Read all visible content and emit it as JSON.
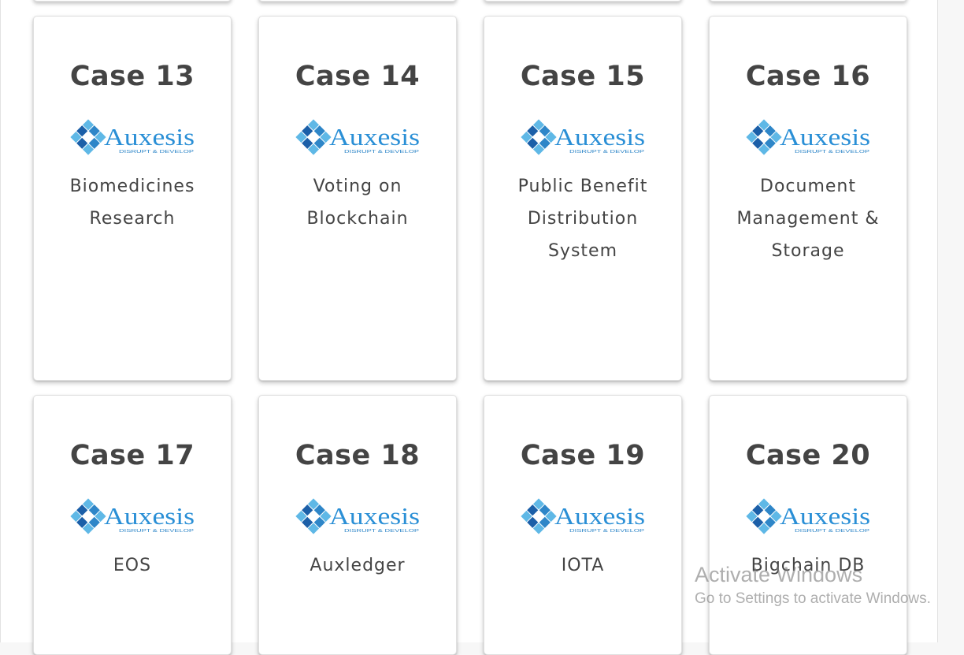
{
  "brand": {
    "logo_text": "Auxesis",
    "tagline": "DISRUPT & DEVELOP",
    "colors": {
      "light_blue": "#5fb8e6",
      "mid_blue": "#2e86c8",
      "dark_blue": "#1b5fa8",
      "text_blue": "#2a8fd6"
    }
  },
  "cards": [
    {
      "title": "Case 13",
      "desc_lines": [
        "Biomedicines",
        "Research"
      ]
    },
    {
      "title": "Case 14",
      "desc_lines": [
        "Voting on",
        "Blockchain"
      ]
    },
    {
      "title": "Case 15",
      "desc_lines": [
        "Public Benefit",
        "Distribution",
        "System"
      ]
    },
    {
      "title": "Case 16",
      "desc_lines": [
        "Document",
        "Management &",
        "Storage"
      ]
    },
    {
      "title": "Case 17",
      "desc_lines": [
        "EOS"
      ]
    },
    {
      "title": "Case 18",
      "desc_lines": [
        "Auxledger"
      ]
    },
    {
      "title": "Case 19",
      "desc_lines": [
        "IOTA"
      ]
    },
    {
      "title": "Case 20",
      "desc_lines": [
        "Bigchain DB"
      ]
    }
  ],
  "watermark": {
    "title": "Activate Windows",
    "subtitle": "Go to Settings to activate Windows."
  }
}
